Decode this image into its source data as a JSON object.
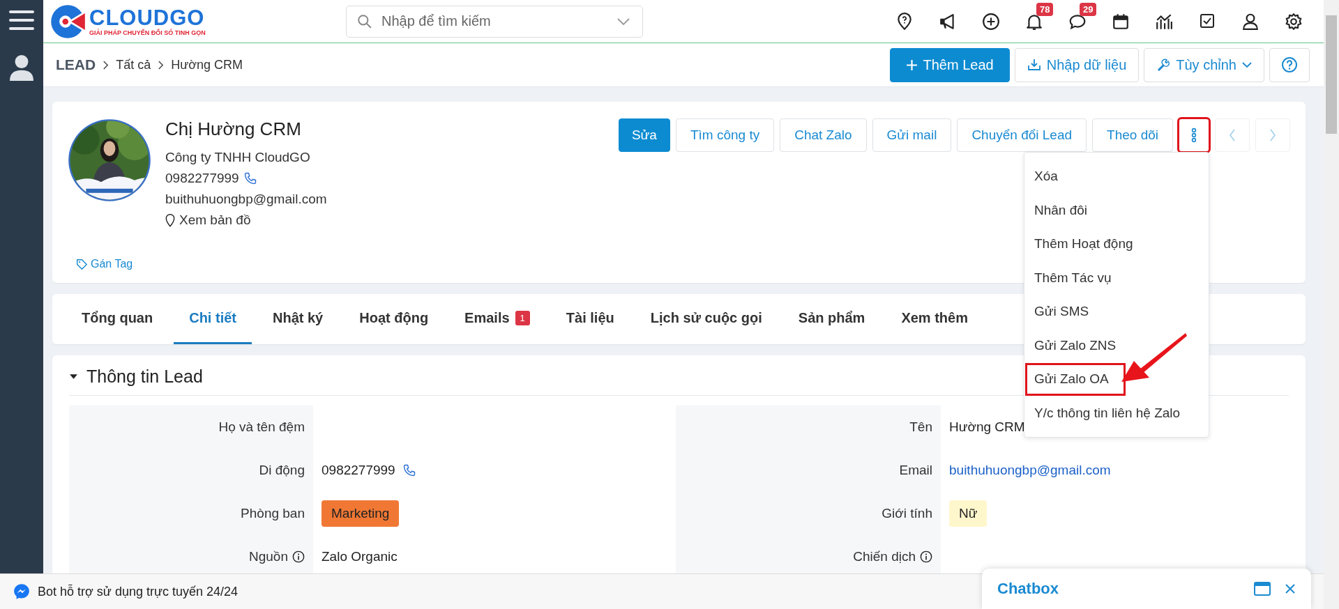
{
  "topbar": {
    "logo": {
      "name": "CLOUDGO",
      "tagline": "GIẢI PHÁP CHUYỂN ĐỔI SỐ TINH GỌN"
    },
    "search": {
      "placeholder": "Nhập để tìm kiếm"
    },
    "icons": [
      {
        "kind": "pin"
      },
      {
        "kind": "megaphone"
      },
      {
        "kind": "plus"
      },
      {
        "kind": "bell",
        "badge": "78"
      },
      {
        "kind": "chat",
        "badge": "29"
      },
      {
        "kind": "calendar"
      },
      {
        "kind": "chart"
      },
      {
        "kind": "check"
      },
      {
        "kind": "user"
      },
      {
        "kind": "gear"
      }
    ]
  },
  "breadcrumb": [
    "LEAD",
    "Tất cả",
    "Hường CRM"
  ],
  "header_buttons": [
    {
      "kind": "primary",
      "label": "Thêm Lead"
    },
    {
      "kind": "import",
      "label": "Nhập dữ liệu"
    },
    {
      "kind": "dropdown",
      "label": "Tùy chỉnh"
    },
    {
      "kind": "help"
    }
  ],
  "profile": {
    "name": "Chị Hường CRM",
    "company": "Công ty TNHH CloudGO",
    "phone": "0982277999",
    "email": "buithuhuongbp@gmail.com",
    "map_link": "Xem bản đồ",
    "tag_link": "Gán Tag"
  },
  "actions": [
    {
      "kind": "primary",
      "label": "Sửa",
      "highlighted": false
    },
    {
      "kind": "outline",
      "label": "Tìm công ty",
      "highlighted": false
    },
    {
      "kind": "outline",
      "label": "Chat Zalo",
      "highlighted": false
    },
    {
      "kind": "outline",
      "label": "Gửi mail",
      "highlighted": false
    },
    {
      "kind": "outline",
      "label": "Chuyển đổi Lead",
      "highlighted": false
    },
    {
      "kind": "outline",
      "label": "Theo dõi",
      "highlighted": false
    },
    {
      "kind": "more",
      "highlighted": true
    },
    {
      "kind": "prev",
      "highlighted": false
    },
    {
      "kind": "next",
      "highlighted": false
    }
  ],
  "menu": {
    "items": [
      {
        "label": "Xóa",
        "highlighted": false
      },
      {
        "label": "Nhân đôi",
        "highlighted": false
      },
      {
        "label": "Thêm Hoạt động",
        "highlighted": false
      },
      {
        "label": "Thêm Tác vụ",
        "highlighted": false
      },
      {
        "label": "Gửi SMS",
        "highlighted": false
      },
      {
        "label": "Gửi Zalo ZNS",
        "highlighted": false
      },
      {
        "label": "Gửi Zalo OA",
        "highlighted": true
      },
      {
        "label": "Y/c thông tin liên hệ Zalo",
        "highlighted": false
      }
    ]
  },
  "tabs": [
    {
      "label": "Tổng quan",
      "selected": false
    },
    {
      "label": "Chi tiết",
      "selected": true
    },
    {
      "label": "Nhật ký",
      "selected": false
    },
    {
      "label": "Hoạt động",
      "selected": false
    },
    {
      "label": "Emails",
      "selected": false,
      "badge": "1"
    },
    {
      "label": "Tài liệu",
      "selected": false
    },
    {
      "label": "Lịch sử cuộc gọi",
      "selected": false
    },
    {
      "label": "Sản phẩm",
      "selected": false
    },
    {
      "label": "Xem thêm",
      "selected": false
    }
  ],
  "section": {
    "title": "Thông tin Lead",
    "expanded": true,
    "rows": [
      [
        {
          "label": "Họ và tên đệm"
        },
        {
          "label": "Tên",
          "kind": "text",
          "value": "Hường CRM"
        }
      ],
      [
        {
          "label": "Di động",
          "kind": "phone",
          "value": "0982277999"
        },
        {
          "label": "Email",
          "kind": "email",
          "value": "buithuhuongbp@gmail.com"
        }
      ],
      [
        {
          "label": "Phòng ban",
          "kind": "tag",
          "value": "Marketing",
          "color": "#f07834"
        },
        {
          "label": "Giới tính",
          "kind": "tag",
          "value": "Nữ",
          "color": "#fff7cc"
        }
      ],
      [
        {
          "label": "Nguồn",
          "kind": "text",
          "info": true,
          "value": "Zalo Organic"
        },
        {
          "label": "Chiến dịch",
          "info": true
        }
      ]
    ]
  },
  "bottom_bar": {
    "text": "Bot hỗ trợ sử dụng trực tuyến 24/24"
  },
  "chatbox": {
    "title": "Chatbox"
  }
}
